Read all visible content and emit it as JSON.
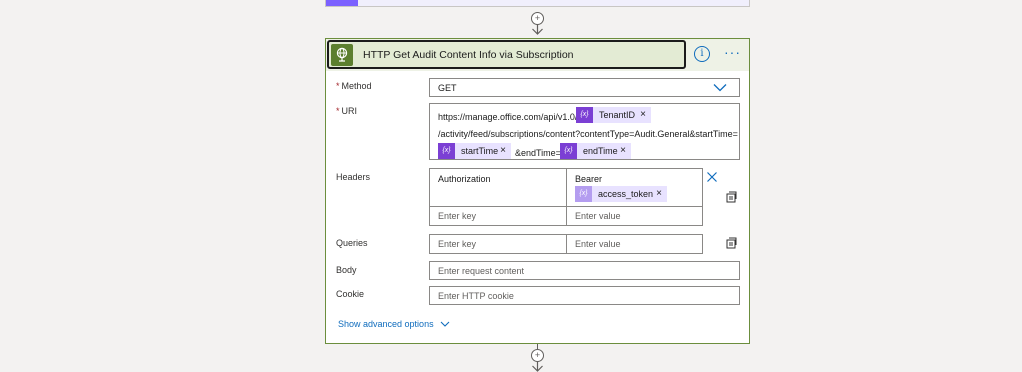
{
  "action": {
    "title": "HTTP Get Audit Content Info via Subscription",
    "info_icon": "info-icon",
    "more_icon": "more-icon",
    "connector_icon": "globe-icon"
  },
  "fields": {
    "method": {
      "label": "Method",
      "required": "*",
      "value": "GET"
    },
    "uri": {
      "label": "URI",
      "required": "*",
      "text_1": "https://manage.office.com/api/v1.0/",
      "token_1": "TenantID",
      "text_2": "/activity/feed/subscriptions/content?contentType=Audit.General&startTime=",
      "token_2": "startTime",
      "text_3": "&endTime=",
      "token_3": "endTime"
    },
    "headers": {
      "label": "Headers",
      "key_1": "Authorization",
      "value_1_text": "Bearer",
      "value_1_token": "access_token",
      "key_placeholder": "Enter key",
      "value_placeholder": "Enter value"
    },
    "queries": {
      "label": "Queries",
      "key_placeholder": "Enter key",
      "value_placeholder": "Enter value"
    },
    "body": {
      "label": "Body",
      "placeholder": "Enter request content"
    },
    "cookie": {
      "label": "Cookie",
      "placeholder": "Enter HTTP cookie"
    }
  },
  "advanced": {
    "label": "Show advanced options"
  },
  "token_icon_glyph": "{x}",
  "remove_glyph": "×",
  "plus_glyph": "+",
  "colors": {
    "card_border": "#6b8e3d",
    "header_bg": "#eef2e6",
    "accent": "#0f6cbd",
    "token_bg": "#e8e2ff",
    "token_icon": "#7b3fd4",
    "required": "#a4262c"
  }
}
